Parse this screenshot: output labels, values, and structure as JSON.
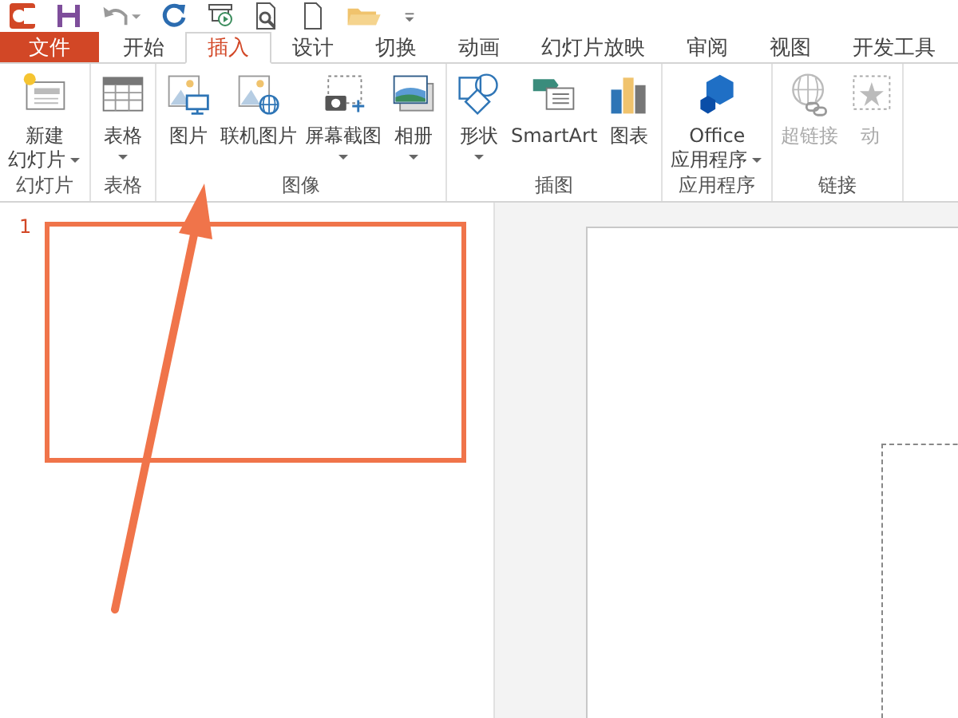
{
  "quick_access": [
    {
      "kind": "app"
    },
    {
      "kind": "save"
    },
    {
      "kind": "undo"
    },
    {
      "kind": "redo"
    },
    {
      "kind": "present"
    },
    {
      "kind": "preview"
    },
    {
      "kind": "new"
    },
    {
      "kind": "open"
    },
    {
      "kind": "more"
    }
  ],
  "tabs": [
    {
      "label": "文件",
      "kind": "file",
      "selected": false
    },
    {
      "label": "开始",
      "kind": "tab",
      "selected": false
    },
    {
      "label": "插入",
      "kind": "tab",
      "selected": true
    },
    {
      "label": "设计",
      "kind": "tab",
      "selected": false
    },
    {
      "label": "切换",
      "kind": "tab",
      "selected": false
    },
    {
      "label": "动画",
      "kind": "tab",
      "selected": false
    },
    {
      "label": "幻灯片放映",
      "kind": "tab",
      "selected": false
    },
    {
      "label": "审阅",
      "kind": "tab",
      "selected": false
    },
    {
      "label": "视图",
      "kind": "tab",
      "selected": false
    },
    {
      "label": "开发工具",
      "kind": "tab",
      "selected": false
    }
  ],
  "ribbon": [
    {
      "label": "幻灯片",
      "buttons": [
        {
          "lines": [
            "新建",
            "幻灯片"
          ],
          "kind": "slide",
          "has_menu": true,
          "disabled": false
        }
      ]
    },
    {
      "label": "表格",
      "buttons": [
        {
          "lines": [
            "表格"
          ],
          "kind": "table",
          "has_menu": true,
          "disabled": false
        }
      ]
    },
    {
      "label": "图像",
      "buttons": [
        {
          "lines": [
            "图片"
          ],
          "kind": "picture",
          "has_menu": false,
          "disabled": false
        },
        {
          "lines": [
            "联机图片"
          ],
          "kind": "online",
          "has_menu": false,
          "disabled": false
        },
        {
          "lines": [
            "屏幕截图"
          ],
          "kind": "screenshot",
          "has_menu": true,
          "disabled": false
        },
        {
          "lines": [
            "相册"
          ],
          "kind": "album",
          "has_menu": true,
          "disabled": false
        }
      ]
    },
    {
      "label": "插图",
      "buttons": [
        {
          "lines": [
            "形状"
          ],
          "kind": "shapes",
          "has_menu": true,
          "disabled": false
        },
        {
          "lines": [
            "SmartArt"
          ],
          "kind": "smartart",
          "has_menu": false,
          "disabled": false
        },
        {
          "lines": [
            "图表"
          ],
          "kind": "chart",
          "has_menu": false,
          "disabled": false
        }
      ]
    },
    {
      "label": "应用程序",
      "buttons": [
        {
          "lines": [
            "Office",
            "应用程序"
          ],
          "kind": "office",
          "has_menu": true,
          "disabled": false
        }
      ]
    },
    {
      "label": "链接",
      "buttons": [
        {
          "lines": [
            "超链接"
          ],
          "kind": "link",
          "has_menu": false,
          "disabled": true
        },
        {
          "lines": [
            "动"
          ],
          "kind": "action",
          "has_menu": false,
          "disabled": true
        }
      ]
    }
  ],
  "slides": [
    {
      "number": "1",
      "selected": true
    }
  ]
}
